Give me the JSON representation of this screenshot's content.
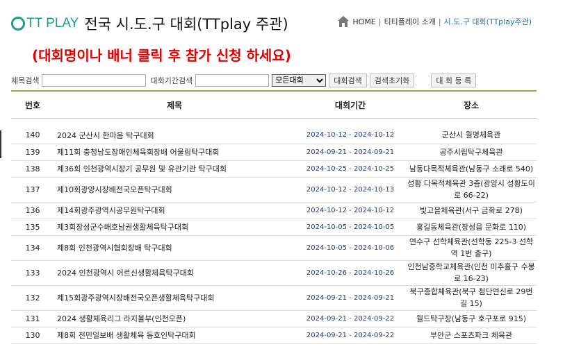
{
  "header": {
    "brand": "TT PLAY",
    "title": "전국 시.도.구 대회(TTplay 주관)"
  },
  "breadcrumb": {
    "home": "HOME",
    "about": "티티플레이 소개",
    "current": "시.도.구 대회(TTplay주관)"
  },
  "notice": "(대회명이나 배너 클릭 후 참가 신청 하세요)",
  "search": {
    "title_label": "제목검색",
    "period_label": "대회기간검색",
    "select_value": "모든대회",
    "search_button": "대회검색",
    "reset_button": "검색초기화",
    "register_button": "대 회 등 록"
  },
  "table": {
    "headers": [
      "번호",
      "제목",
      "대회기간",
      "장소"
    ],
    "rows": [
      {
        "no": "140",
        "title": "2024 군산시 한마음 탁구대회",
        "period": "2024-10-12 - 2024-10-12",
        "place": "군산시 월명체육관"
      },
      {
        "no": "139",
        "title": "제11회 충청남도장애인체육회장배 어울림탁구대회",
        "period": "2024-09-21 - 2024-09-21",
        "place": "공주시립탁구체육관"
      },
      {
        "no": "138",
        "title": "제36회 인천광역시장기 공무원 및 유관기관 탁구대회",
        "period": "2024-10-25 - 2024-10-25",
        "place": "남동다목적체육관(남동구 소래로 540)"
      },
      {
        "no": "137",
        "title": "제10회광양시장배전국오픈탁구대회",
        "period": "2024-10-12 - 2024-10-13",
        "place": "성황 다목적체육관 3층(광양시 성황도이로 66-22)"
      },
      {
        "no": "136",
        "title": "제14회광주광역시공무원탁구대회",
        "period": "2024-10-12 - 2024-10-12",
        "place": "빛고을체육관(서구 금화로 278)"
      },
      {
        "no": "135",
        "title": "제3회장성군수배호남권생활체육탁구대회",
        "period": "2024-10-05 - 2024-10-05",
        "place": "홍길동체육관(장성읍 문화로 110)"
      },
      {
        "no": "134",
        "title": "제8회 인천광역시협회장배 탁구대회",
        "period": "2024-10-05 - 2024-10-06",
        "place": "연수구 선학체육관(선학동 225-3 선학역 1번 출구)"
      },
      {
        "no": "133",
        "title": "2024 인천광역시 어르신생활체육탁구대회",
        "period": "2024-10-26 - 2024-10-26",
        "place": "인천남중학교체육관(인천 미추홀구 수봉로 16-23)"
      },
      {
        "no": "132",
        "title": "제15회광주광역시장배전국오픈생활체육탁구대회",
        "period": "2024-09-21 - 2024-09-21",
        "place": "북구종합체육관(북구 첨단연신로 29번길 15)"
      },
      {
        "no": "131",
        "title": "2024 생활체육리그 라지볼부(인천오픈)",
        "period": "2024-09-21 - 2024-09-22",
        "place": "월드탁구장(남동구 호구포로 915)"
      },
      {
        "no": "130",
        "title": "제8회 전민일보배 생활체육 동호인탁구대회",
        "period": "2024-09-21 - 2024-09-22",
        "place": "부안군 스포츠파크 체육관"
      }
    ]
  }
}
